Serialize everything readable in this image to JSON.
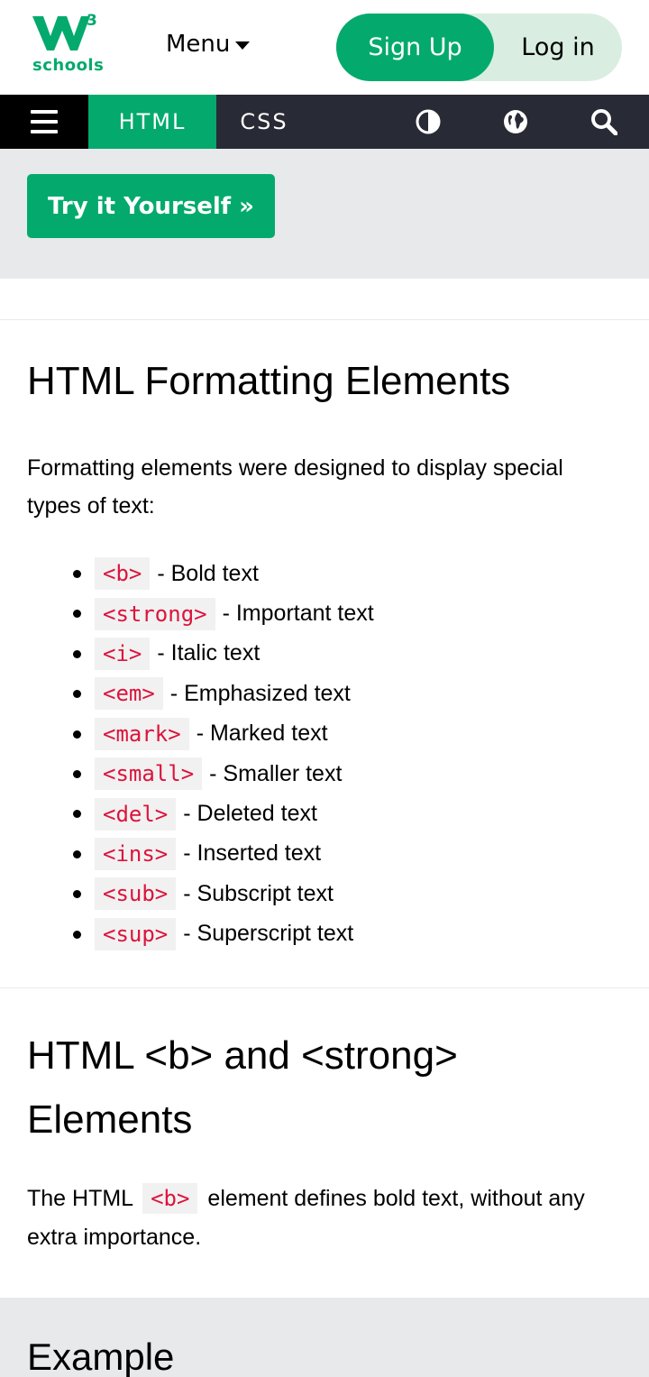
{
  "header": {
    "logo_text": "schools",
    "logo_sup": "3",
    "menu_label": "Menu",
    "signup_label": "Sign Up",
    "login_label": "Log in"
  },
  "navbar": {
    "html_label": "HTML",
    "css_label": "CSS",
    "icons": [
      "menu-icon",
      "contrast-icon",
      "globe-icon",
      "search-icon"
    ]
  },
  "try_button": "Try it Yourself »",
  "section1": {
    "title": "HTML Formatting Elements",
    "intro": "Formatting elements were designed to display special types of text:",
    "items": [
      {
        "tag": "<b>",
        "desc": "- Bold text"
      },
      {
        "tag": "<strong>",
        "desc": "- Important text"
      },
      {
        "tag": "<i>",
        "desc": "- Italic text"
      },
      {
        "tag": "<em>",
        "desc": "- Emphasized text"
      },
      {
        "tag": "<mark>",
        "desc": "- Marked text"
      },
      {
        "tag": "<small>",
        "desc": "- Smaller text"
      },
      {
        "tag": "<del>",
        "desc": "- Deleted text"
      },
      {
        "tag": "<ins>",
        "desc": "- Inserted text"
      },
      {
        "tag": "<sub>",
        "desc": "- Subscript text"
      },
      {
        "tag": "<sup>",
        "desc": "- Superscript text"
      }
    ]
  },
  "section2": {
    "title": "HTML <b> and <strong> Elements",
    "para_before": "The HTML",
    "para_code": "<b>",
    "para_after": "element defines bold text, without any extra importance."
  },
  "example": {
    "title": "Example"
  },
  "colors": {
    "brand": "#04AA6D",
    "navbar": "#282A35",
    "code": "#dc143c"
  }
}
